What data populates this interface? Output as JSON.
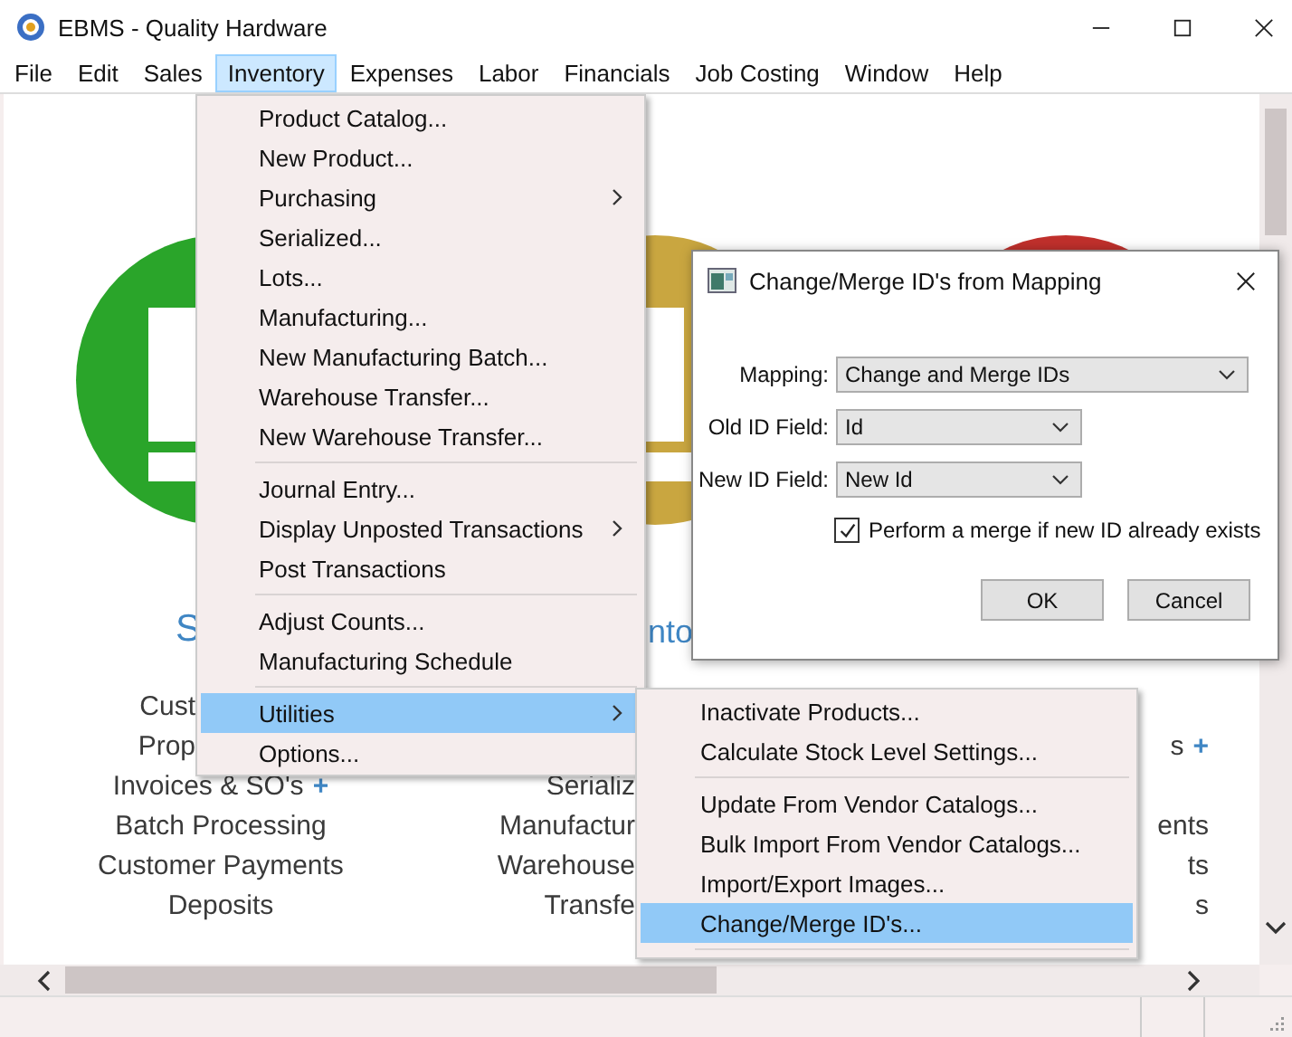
{
  "window": {
    "title": "EBMS - Quality Hardware"
  },
  "menu_bar": [
    {
      "label": "File",
      "selected": false
    },
    {
      "label": "Edit",
      "selected": false
    },
    {
      "label": "Sales",
      "selected": false
    },
    {
      "label": "Inventory",
      "selected": true
    },
    {
      "label": "Expenses",
      "selected": false
    },
    {
      "label": "Labor",
      "selected": false
    },
    {
      "label": "Financials",
      "selected": false
    },
    {
      "label": "Job Costing",
      "selected": false
    },
    {
      "label": "Window",
      "selected": false
    },
    {
      "label": "Help",
      "selected": false
    }
  ],
  "dashboard": {
    "columns": [
      {
        "heading": "S",
        "links": [
          {
            "text": "Cust"
          },
          {
            "text": "Prop"
          },
          {
            "text": "Invoices & SO's",
            "add": "+"
          },
          {
            "text": "Batch Processing"
          },
          {
            "text": "Customer Payments"
          },
          {
            "text": "Deposits"
          }
        ]
      },
      {
        "heading": "nto",
        "links": [
          {
            "text": "Serializ"
          },
          {
            "text": "Manufactur"
          },
          {
            "text": "Warehouse"
          },
          {
            "text": "Transfe"
          }
        ]
      },
      {
        "links": [
          {
            "text": "s",
            "add": "+"
          },
          {
            "text": "ents"
          },
          {
            "text": "ts"
          },
          {
            "text": "s"
          }
        ]
      }
    ]
  },
  "inventory_menu": [
    {
      "kind": "item",
      "label": "Product Catalog...",
      "submenu": false,
      "selected": false
    },
    {
      "kind": "item",
      "label": "New Product...",
      "submenu": false,
      "selected": false
    },
    {
      "kind": "item",
      "label": "Purchasing",
      "submenu": true,
      "selected": false
    },
    {
      "kind": "item",
      "label": "Serialized...",
      "submenu": false,
      "selected": false
    },
    {
      "kind": "item",
      "label": "Lots...",
      "submenu": false,
      "selected": false
    },
    {
      "kind": "item",
      "label": "Manufacturing...",
      "submenu": false,
      "selected": false
    },
    {
      "kind": "item",
      "label": "New Manufacturing Batch...",
      "submenu": false,
      "selected": false
    },
    {
      "kind": "item",
      "label": "Warehouse Transfer...",
      "submenu": false,
      "selected": false
    },
    {
      "kind": "item",
      "label": "New Warehouse Transfer...",
      "submenu": false,
      "selected": false
    },
    {
      "kind": "separator"
    },
    {
      "kind": "item",
      "label": "Journal Entry...",
      "submenu": false,
      "selected": false
    },
    {
      "kind": "item",
      "label": "Display Unposted Transactions",
      "submenu": true,
      "selected": false
    },
    {
      "kind": "item",
      "label": "Post Transactions",
      "submenu": false,
      "selected": false
    },
    {
      "kind": "separator"
    },
    {
      "kind": "item",
      "label": "Adjust Counts...",
      "submenu": false,
      "selected": false
    },
    {
      "kind": "item",
      "label": "Manufacturing Schedule",
      "submenu": false,
      "selected": false
    },
    {
      "kind": "separator"
    },
    {
      "kind": "item",
      "label": "Utilities",
      "submenu": true,
      "selected": true
    },
    {
      "kind": "item",
      "label": "Options...",
      "submenu": false,
      "selected": false
    }
  ],
  "utilities_menu": [
    {
      "kind": "item",
      "label": "Inactivate Products...",
      "selected": false
    },
    {
      "kind": "item",
      "label": "Calculate Stock Level Settings...",
      "selected": false
    },
    {
      "kind": "separator"
    },
    {
      "kind": "item",
      "label": "Update From Vendor Catalogs...",
      "selected": false
    },
    {
      "kind": "item",
      "label": "Bulk Import From Vendor Catalogs...",
      "selected": false
    },
    {
      "kind": "item",
      "label": "Import/Export Images...",
      "selected": false
    },
    {
      "kind": "item",
      "label": "Change/Merge ID's...",
      "selected": true
    },
    {
      "kind": "separator"
    }
  ],
  "dialog": {
    "title": "Change/Merge ID's from Mapping",
    "fields": [
      {
        "label": "Mapping:",
        "value": "Change and Merge IDs",
        "wide": true
      },
      {
        "label": "Old ID Field:",
        "value": "Id",
        "wide": false
      },
      {
        "label": "New ID Field:",
        "value": "New Id",
        "wide": false
      }
    ],
    "checkbox": {
      "label": "Perform a merge if new ID already exists",
      "checked": true
    },
    "buttons": [
      "OK",
      "Cancel"
    ]
  }
}
